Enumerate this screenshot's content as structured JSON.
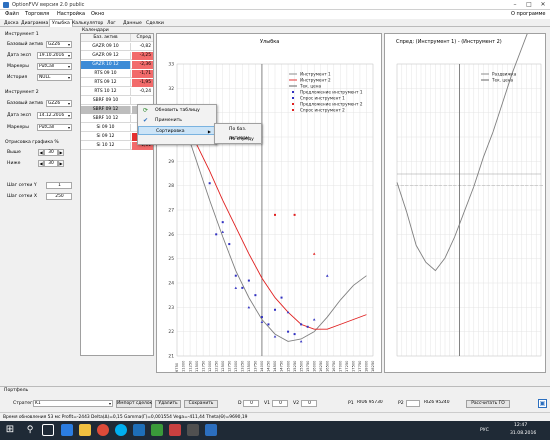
{
  "window": {
    "title": "OptionFVV версия 2.0 public"
  },
  "menu": {
    "items": [
      "Файл",
      "Торговля",
      "Настройка",
      "Окно"
    ],
    "about": "О программе"
  },
  "tabs": {
    "items": [
      "Доска",
      "Диаграмма",
      "Улыбка",
      "Калькулятор",
      "Лог",
      "Данные",
      "Сделки"
    ],
    "active": "Улыбка"
  },
  "instrument1": {
    "header": "Инструмент 1",
    "base_label": "Базовый актив",
    "base_value": "GZZ6",
    "date_label": "Дата эксп",
    "date_value": "19.10.2016",
    "marker_label": "Маркеры",
    "marker_value": "PutCall",
    "history_label": "История",
    "history_value": "NULL"
  },
  "instrument2": {
    "header": "Инструмент 2",
    "base_label": "Базовый актив",
    "base_value": "GZZ6",
    "date_label": "Дата эксп",
    "date_value": "14.12.2016",
    "marker_label": "Маркеры",
    "marker_value": "PutCall"
  },
  "bounds": {
    "header": "Отрисовка графика %",
    "above_label": "Выше",
    "above_value": "30",
    "below_label": "Ниже",
    "below_value": "30"
  },
  "grid": {
    "y_label": "Шаг сетки Y",
    "y_value": "1",
    "x_label": "Шаг сетки X",
    "x_value": "250"
  },
  "calendar": {
    "title": "Календари",
    "col_asset": "Баз. актив",
    "col_spread": "Спред",
    "rows": [
      {
        "asset": "GAZR 09 10",
        "spread": "-0,82",
        "style": "none"
      },
      {
        "asset": "GAZR 09 12",
        "spread": "-3,25",
        "style": "neg"
      },
      {
        "asset": "GAZR 10 12",
        "spread": "-2,36",
        "style": "sel1neg"
      },
      {
        "asset": "RTS 09 10",
        "spread": "-1,71",
        "style": "neg"
      },
      {
        "asset": "RTS 09 12",
        "spread": "-1,95",
        "style": "neg"
      },
      {
        "asset": "RTS 10 12",
        "spread": "-0,24",
        "style": "none"
      },
      {
        "asset": "SBRF 09 10",
        "spread": "",
        "style": "none"
      },
      {
        "asset": "SBRF 09 12",
        "spread": "",
        "style": "sel2"
      },
      {
        "asset": "SBRF 10 12",
        "spread": "",
        "style": "none"
      },
      {
        "asset": "Si 09 10",
        "spread": "-0,...",
        "style": "none"
      },
      {
        "asset": "Si 09 12",
        "spread": "-2,19",
        "style": "negd"
      },
      {
        "asset": "Si 10 12",
        "spread": "-1,61",
        "style": "neg"
      }
    ]
  },
  "context_menu": {
    "items": [
      "Обновить таблицу",
      "Применить",
      "Сортировка"
    ],
    "submenu": [
      "По баз. активам",
      "По спреду"
    ]
  },
  "smile_chart": {
    "title": "Улыбка"
  },
  "spread_chart": {
    "title": "Спред: (Инструмент 1) - (Инструмент 2)"
  },
  "chart_data": [
    {
      "type": "line",
      "title": "Улыбка",
      "ylim": [
        21,
        33
      ],
      "yticks": [
        21,
        22,
        23,
        24,
        25,
        26,
        27,
        28,
        29,
        30,
        31,
        32,
        33
      ],
      "xticks": [
        "6750",
        "11000",
        "11250",
        "11500",
        "11750",
        "12000",
        "12250",
        "12500",
        "12750",
        "13000",
        "13250",
        "13500",
        "13750",
        "14000",
        "14250",
        "14500",
        "14750",
        "15000",
        "15250",
        "15500",
        "15750",
        "16000",
        "16250",
        "16500",
        "16750",
        "17000",
        "17250",
        "17500",
        "17750",
        "18000",
        "18250"
      ],
      "legend": [
        "Инструмент 1",
        "Инструмент 2",
        "Тек. цена",
        "Предложение инструмент 1",
        "Спрос инструмент 1",
        "Предложение инструмент 2",
        "Спрос инструмент 2"
      ],
      "legend_position": "top-right",
      "series": [
        {
          "name": "Инструмент 1",
          "color": "#808080",
          "x": [
            1,
            3,
            5,
            7,
            9,
            11,
            13,
            15,
            17,
            19,
            21,
            23,
            25,
            27,
            29
          ],
          "y": [
            30.6,
            29.0,
            27.4,
            25.9,
            24.5,
            23.4,
            22.5,
            21.9,
            21.6,
            21.7,
            22.0,
            22.6,
            23.3,
            23.9,
            24.3
          ]
        },
        {
          "name": "Инструмент 2",
          "color": "#e02020",
          "x": [
            1,
            3,
            5,
            7,
            9,
            11,
            13,
            15,
            17,
            19,
            21,
            23,
            25,
            27,
            29
          ],
          "y": [
            30.8,
            29.7,
            28.6,
            27.4,
            26.3,
            25.2,
            24.2,
            23.4,
            22.8,
            22.3,
            22.1,
            22.1,
            22.3,
            22.5,
            22.7
          ]
        },
        {
          "name": "Предложение инструмент 1",
          "color": "#3030c0",
          "marker": "point",
          "x": [
            5,
            6,
            7,
            8,
            9,
            10,
            11,
            12,
            13,
            14,
            15,
            16,
            17,
            18,
            19,
            20
          ],
          "y": [
            28.1,
            26.0,
            26.5,
            25.6,
            24.3,
            23.8,
            24.1,
            23.5,
            22.6,
            22.3,
            22.9,
            23.4,
            22.0,
            21.9,
            22.3,
            22.2
          ]
        },
        {
          "name": "Спрос инструмент 1",
          "color": "#3030c0",
          "marker": "point",
          "x": [
            7,
            9,
            11,
            13,
            15,
            17,
            19,
            21,
            23
          ],
          "y": [
            26.1,
            23.8,
            23.0,
            22.4,
            21.8,
            22.8,
            21.6,
            22.5,
            24.3
          ]
        },
        {
          "name": "Предложение инструмент 2",
          "color": "#e02020",
          "marker": "point",
          "x": [
            15,
            18
          ],
          "y": [
            26.8,
            26.8
          ]
        },
        {
          "name": "Спрос инструмент 2",
          "color": "#e02020",
          "marker": "point",
          "x": [
            21
          ],
          "y": [
            25.2
          ]
        }
      ],
      "current_price_x": 13
    },
    {
      "type": "line",
      "title": "Спред: (Инструмент 1) - (Инструмент 2)",
      "legend": [
        "Раздвижка",
        "Тек. цена"
      ],
      "legend_position": "top-right",
      "series": [
        {
          "name": "Раздвижка",
          "color": "#808080",
          "x": [
            0,
            2,
            4,
            6,
            8,
            10,
            12,
            14,
            16,
            18,
            20,
            22,
            24,
            26,
            28,
            30
          ],
          "y": [
            -0.2,
            -0.9,
            -1.7,
            -2.1,
            -2.3,
            -2.0,
            -1.5,
            -0.9,
            -0.3,
            0.4,
            1.0,
            1.7,
            2.4,
            3.0,
            3.6,
            4.2
          ]
        }
      ],
      "current_price_x": 13
    }
  ],
  "portfolio": {
    "title": "Портфель",
    "strategy_label": "Стратегия",
    "strategy_value": "K1",
    "import_button": "Импорт сделок",
    "delete_button": "Удалить",
    "save_button": "Сохранить",
    "d_label": "D",
    "d_value": "0",
    "v1_label": "V1",
    "v1_value": "0",
    "v2_label": "V2",
    "v2_value": "0",
    "p1_label": "P1",
    "p1_value": "RIU6 95730",
    "p2_label": "P2",
    "p2_value": "RIZ6 95240",
    "calc_button": "Рассчитать ГО"
  },
  "status": {
    "text": "Время обновления 53 мс  Profit=-2443 Delta(Δ)=0,15 Gamma(Γ)=0,001554 Vega=-411,44 Theta(Θ)=9690,19"
  },
  "taskbar": {
    "search_icon": "search-icon",
    "lang": "РУС",
    "time": "12:47",
    "date": "31.08.2016"
  }
}
